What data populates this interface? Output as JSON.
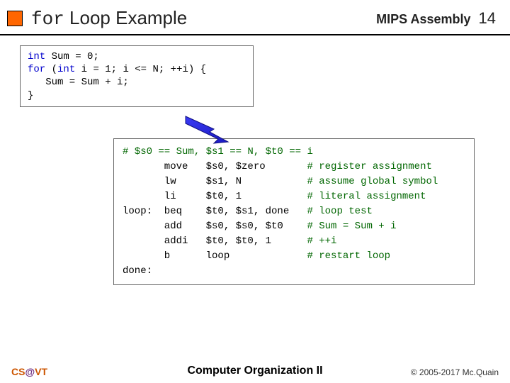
{
  "header": {
    "title_prefix": "for",
    "title_rest": " Loop Example",
    "right_label": "MIPS Assembly",
    "page_number": "14"
  },
  "c_code": {
    "line1_kw": "int",
    "line1_rest": " Sum = 0;",
    "line2_kw1": "for",
    "line2_mid": " (",
    "line2_kw2": "int",
    "line2_rest": " i = 1; i <= N; ++i) {",
    "line3": "   Sum = Sum + i;",
    "line4": "}"
  },
  "asm": {
    "l0": "# $s0 == Sum, $s1 == N, $t0 == i",
    "l1a": "       move   $s0, $zero       ",
    "l1c": "# register assignment",
    "l2a": "       lw     $s1, N           ",
    "l2c": "# assume global symbol",
    "l3a": "       li     $t0, 1           ",
    "l3c": "# literal assignment",
    "l4a": "loop:  beq    $t0, $s1, done   ",
    "l4c": "# loop test",
    "l5a": "       add    $s0, $s0, $t0    ",
    "l5c": "# Sum = Sum + i",
    "l6a": "       addi   $t0, $t0, 1      ",
    "l6c": "# ++i",
    "l7a": "       b      loop             ",
    "l7c": "# restart loop",
    "l8": "done:"
  },
  "footer": {
    "left_pre": "CS",
    "left_at": "@",
    "left_post": "VT",
    "center": "Computer Organization II",
    "right": "© 2005-2017 Mc.Quain"
  }
}
